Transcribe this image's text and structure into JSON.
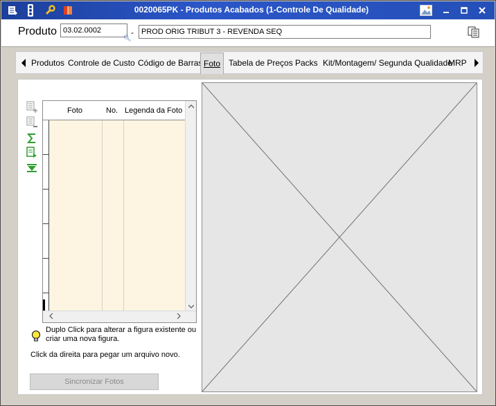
{
  "window": {
    "title": "0020065PK - Produtos Acabados (1-Controle De Qualidade)"
  },
  "header": {
    "label": "Produto",
    "code_value": "03.02.0002",
    "separator": "-",
    "description_value": "PROD ORIG TRIBUT 3 - REVENDA SEQ"
  },
  "tabs": [
    {
      "label": "Produtos"
    },
    {
      "label": "Controle de Custo"
    },
    {
      "label": "Código de Barras"
    },
    {
      "label": "Foto"
    },
    {
      "label": "Tabela de Preços"
    },
    {
      "label": "Packs"
    },
    {
      "label": "Kit/Montagem/ Segunda Qualidade"
    },
    {
      "label": "MRP"
    }
  ],
  "active_tab": "Foto",
  "grid": {
    "columns": [
      {
        "label": "Foto"
      },
      {
        "label": "No."
      },
      {
        "label": "Legenda da Foto"
      }
    ],
    "rows": []
  },
  "hints": {
    "double_click": "Duplo Click para alterar a figura existente ou criar uma nova figura.",
    "right_click": "Click da direita para pegar um arquivo novo."
  },
  "buttons": {
    "sync": "Sincronizar Fotos"
  },
  "colors": {
    "titlebar": "#2550b8",
    "grid_body": "#fdf5e1",
    "tool_green": "#2e9e2e"
  }
}
